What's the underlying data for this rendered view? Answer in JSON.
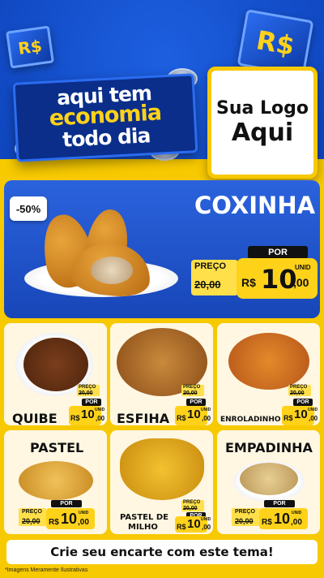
{
  "header": {
    "slogan_line1": "aqui tem",
    "slogan_line2": "economia",
    "slogan_line3": "todo dia",
    "logo_line1": "Sua Logo",
    "logo_line2": "Aqui",
    "badge_text": "R$"
  },
  "featured": {
    "discount": "-50%",
    "title": "COXINHA",
    "preco_label": "PREÇO",
    "old_price": "20,00",
    "por_label": "POR",
    "currency": "R$",
    "price_int": "10",
    "price_dec": ",00",
    "unit": "UNID"
  },
  "products": [
    {
      "name": "QUIBE",
      "por": "POR",
      "currency": "R$",
      "price_int": "10",
      "price_dec": ",00",
      "old_label": "PREÇO",
      "old_price": "20,00",
      "unit": "UNID"
    },
    {
      "name": "ESFIHA",
      "por": "POR",
      "currency": "R$",
      "price_int": "10",
      "price_dec": ",00",
      "old_label": "PREÇO",
      "old_price": "20,00",
      "unit": "UNID"
    },
    {
      "name": "ENROLADINHO",
      "por": "POR",
      "currency": "R$",
      "price_int": "10",
      "price_dec": ",00",
      "old_label": "PREÇO",
      "old_price": "20,00",
      "unit": "UNID"
    },
    {
      "name": "PASTEL",
      "por": "POR",
      "currency": "R$",
      "price_int": "10",
      "price_dec": ",00",
      "old_label": "PREÇO",
      "old_price": "20,00",
      "unit": "UNID"
    },
    {
      "name_line1": "PASTEL DE",
      "name_line2": "MILHO",
      "por": "POR",
      "currency": "R$",
      "price_int": "10",
      "price_dec": ",00",
      "old_label": "PREÇO",
      "old_price": "20,00",
      "unit": "UNID"
    },
    {
      "name": "EMPADINHA",
      "por": "POR",
      "currency": "R$",
      "price_int": "10",
      "price_dec": ",00",
      "old_label": "PREÇO",
      "old_price": "20,00",
      "unit": "UNID"
    }
  ],
  "cta": "Crie seu encarte com este tema!",
  "footnote": "*Imagens Meramente Ilustrativas",
  "colors": {
    "blue": "#1746b8",
    "yellow": "#f7c900",
    "price_yellow": "#ffd21a"
  },
  "icons": [
    "currency-cube-icon",
    "coin-icon",
    "food-photo-icon"
  ]
}
